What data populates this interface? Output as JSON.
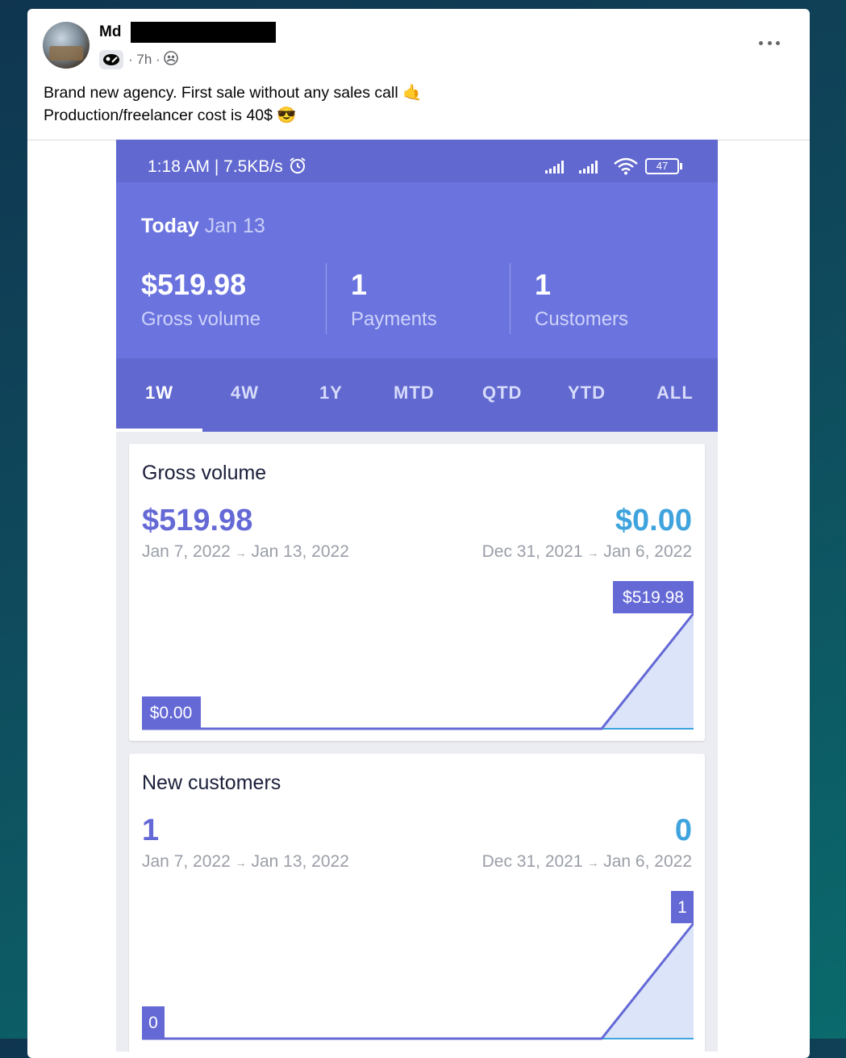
{
  "post": {
    "author": "Md",
    "time": "7h",
    "line1": "Brand new agency. First sale without any sales call 🤙",
    "line2": "Production/freelancer cost is 40$ 😎",
    "options_glyph": "•••"
  },
  "phone": {
    "status": {
      "time_speed": "1:18 AM | 7.5KB/s",
      "battery": "47"
    },
    "header": {
      "today_label": "Today",
      "today_date": "Jan 13",
      "stats": [
        {
          "value": "$519.98",
          "label": "Gross volume"
        },
        {
          "value": "1",
          "label": "Payments"
        },
        {
          "value": "1",
          "label": "Customers"
        }
      ]
    },
    "tabs": [
      "1W",
      "4W",
      "1Y",
      "MTD",
      "QTD",
      "YTD",
      "ALL"
    ],
    "active_tab": "1W",
    "gross_volume": {
      "title": "Gross volume",
      "current_value": "$519.98",
      "current_range_start": "Jan 7, 2022",
      "current_range_end": "Jan 13, 2022",
      "previous_value": "$0.00",
      "previous_range_start": "Dec 31, 2021",
      "previous_range_end": "Jan 6, 2022",
      "min_label": "$0.00",
      "max_label": "$519.98"
    },
    "new_customers": {
      "title": "New customers",
      "current_value": "1",
      "current_range_start": "Jan 7, 2022",
      "current_range_end": "Jan 13, 2022",
      "previous_value": "0",
      "previous_range_start": "Dec 31, 2021",
      "previous_range_end": "Jan 6, 2022",
      "min_label": "0",
      "max_label": "1"
    },
    "arrow": "→"
  },
  "colors": {
    "primary": "#6168cf",
    "header": "#6b73de",
    "accent_blue": "#3fa3dd",
    "area_fill": "#dbe4f8"
  },
  "icons": [
    "alarm-icon",
    "signal-icon",
    "wifi-icon",
    "battery-icon",
    "profile-badge-icon",
    "friends-audience-icon",
    "more-options-icon"
  ]
}
